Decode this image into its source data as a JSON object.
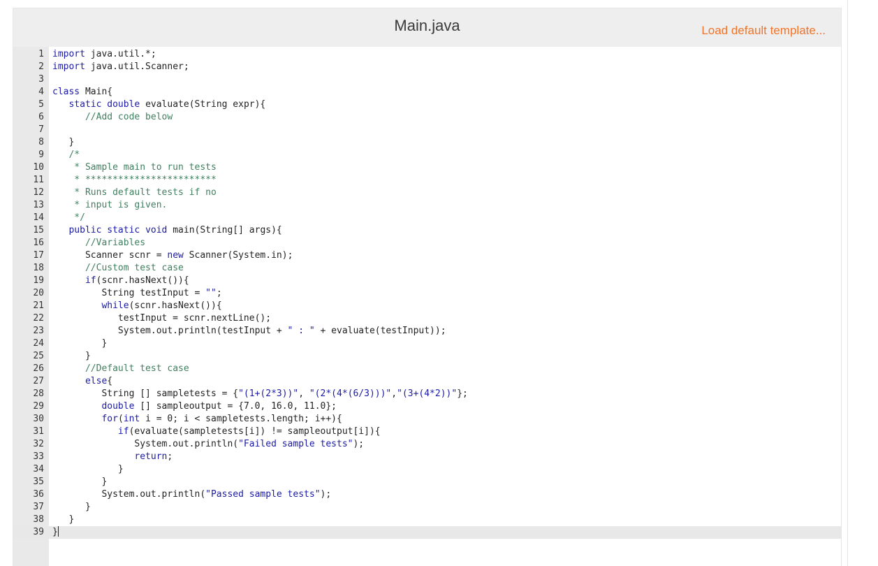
{
  "header": {
    "file_name": "Main.java",
    "load_template_label": "Load default template..."
  },
  "editor": {
    "lines": [
      "import java.util.*;",
      "import java.util.Scanner;",
      "",
      "class Main{",
      "   static double evaluate(String expr){",
      "      //Add code below",
      "",
      "   }",
      "   /*",
      "    * Sample main to run tests",
      "    * ************************",
      "    * Runs default tests if no",
      "    * input is given.",
      "    */",
      "   public static void main(String[] args){",
      "      //Variables",
      "      Scanner scnr = new Scanner(System.in);",
      "      //Custom test case",
      "      if(scnr.hasNext()){",
      "         String testInput = \"\";",
      "         while(scnr.hasNext()){",
      "            testInput = scnr.nextLine();",
      "            System.out.println(testInput + \" : \" + evaluate(testInput));",
      "         }",
      "      }",
      "      //Default test case",
      "      else{",
      "         String [] sampletests = {\"(1+(2*3))\", \"(2*(4*(6/3)))\",\"(3+(4*2))\"};",
      "         double [] sampleoutput = {7.0, 16.0, 11.0};",
      "         for(int i = 0; i < sampletests.length; i++){",
      "            if(evaluate(sampletests[i]) != sampleoutput[i]){",
      "               System.out.println(\"Failed sample tests\");",
      "               return;",
      "            }",
      "         }",
      "         System.out.println(\"Passed sample tests\");",
      "      }",
      "   }",
      "}"
    ],
    "active_line": 39
  }
}
